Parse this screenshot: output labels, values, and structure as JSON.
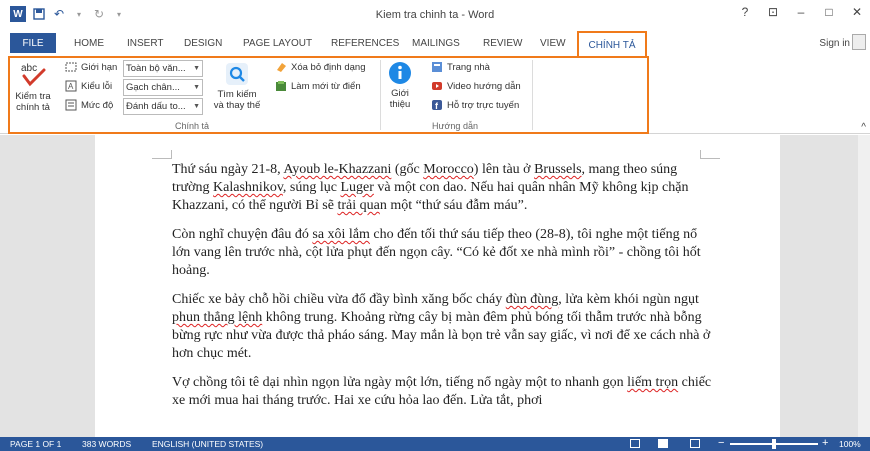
{
  "titlebar": {
    "title": "Kiem tra chinh ta - Word",
    "controls": [
      "?",
      "⊡",
      "–",
      "□",
      "✕"
    ]
  },
  "tabs": {
    "file": "FILE",
    "items": [
      "HOME",
      "INSERT",
      "DESIGN",
      "PAGE LAYOUT",
      "REFERENCES",
      "MAILINGS",
      "REVIEW",
      "VIEW"
    ],
    "active": "CHÍNH TẢ",
    "signin": "Sign in"
  },
  "ribbon": {
    "kiemtra": {
      "line1": "Kiểm tra",
      "line2": "chính tả"
    },
    "gioihan": "Giới hạn",
    "kieuloi": "Kiểu lỗi",
    "mucdo": "Mức độ",
    "dd1": "Toàn bộ văn...",
    "dd2": "Gạch chân...",
    "dd3": "Đánh dấu to...",
    "timkiem": {
      "line1": "Tìm kiếm",
      "line2": "và thay thế"
    },
    "xoabo": "Xóa bỏ định dạng",
    "lammoi": "Làm mới từ điển",
    "gioithieu": {
      "line1": "Giới",
      "line2": "thiệu"
    },
    "trangnha": "Trang nhà",
    "video": "Video hướng dẫn",
    "hotro": "Hỗ trợ trực tuyến",
    "group1": "Chính tả",
    "group2": "Hướng dẫn"
  },
  "document": {
    "p1": {
      "a": "Thứ sáu ngày 21-8, ",
      "b": "Ayoub le-Khazzani",
      "c": " (gốc ",
      "d": "Morocco",
      "e": ") lên tàu ở ",
      "f": "Brussels",
      "g": ", mang theo súng trường ",
      "h": "Kalashnikov",
      "i": ", súng lục ",
      "j": "Luger",
      "k": " và một con dao. Nếu hai quân nhân Mỹ không kịp chặn Khazzani, có thể người Bỉ sẽ ",
      "l": "trải qua",
      "m": "n một “thứ sáu đẫm máu”."
    },
    "p2": {
      "a": "Còn nghĩ chuyện đâu đó ",
      "b": "sa xôi lắm",
      "c": " cho đến tối thứ sáu tiếp theo (28-8), tôi nghe một tiếng nổ lớn vang lên trước nhà, cột lửa phụt đến ngọn cây. “Có kẻ đốt xe nhà mình rồi” - chồng tôi hốt hoảng."
    },
    "p3": {
      "a": "Chiếc xe bảy chỗ hồi chiều vừa đổ đầy bình xăng bốc cháy ",
      "b": "đùn đùng",
      "c": ", lửa kèm khói ngùn ngụt ",
      "d": "phun thẳng lệnh",
      "e": " không trung. Khoảng rừng cây bị màn đêm phủ bóng tối thẫm trước nhà bỗng bừng rực như vừa được thả pháo sáng. May mắn là bọn trẻ vẫn say giấc, vì nơi để xe cách nhà ở hơn chục mét."
    },
    "p4": {
      "a": "Vợ chồng tôi tê dại nhìn ngọn lửa ngày một lớn, tiếng nổ ngày một to nhanh gọn ",
      "b": "liếm trọn",
      "c": " chiếc xe mới mua hai tháng trước. Hai xe cứu hỏa lao đến. Lửa tắt, phơi"
    }
  },
  "status": {
    "page": "PAGE 1 OF 1",
    "words": "383 WORDS",
    "lang": "ENGLISH (UNITED STATES)",
    "zoom": "100%"
  },
  "colors": {
    "accent": "#2b579a",
    "highlight": "#f07a1a"
  }
}
